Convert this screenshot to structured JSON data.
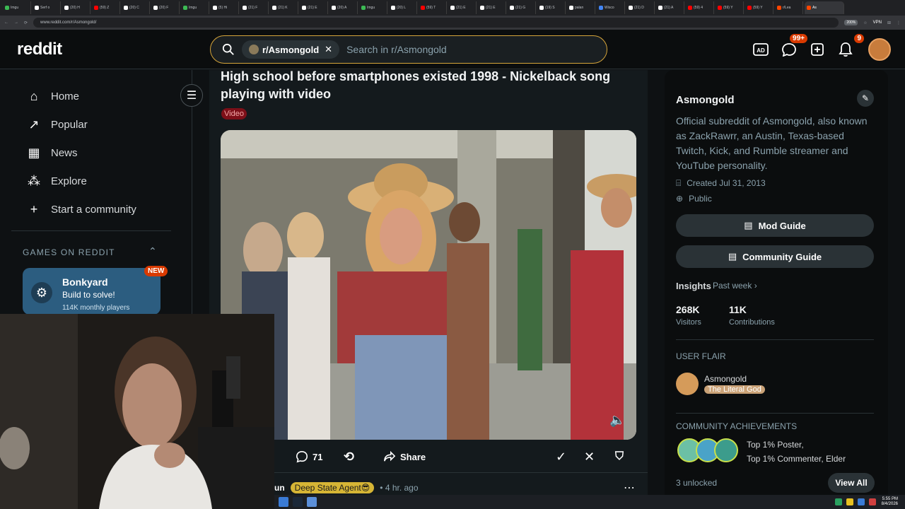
{
  "browser": {
    "tabs": [
      {
        "label": "Imgu",
        "color": "#3cba54"
      },
      {
        "label": "Serf o",
        "color": "#ffffff"
      },
      {
        "label": "(20) H",
        "color": "#ffffff"
      },
      {
        "label": "(59) Z",
        "color": "#ff0000"
      },
      {
        "label": "(20) C",
        "color": "#ffffff"
      },
      {
        "label": "(20) F",
        "color": "#ffffff"
      },
      {
        "label": "Imgu",
        "color": "#3cba54"
      },
      {
        "label": "(5) Hi",
        "color": "#ffffff"
      },
      {
        "label": "(21) F",
        "color": "#ffffff"
      },
      {
        "label": "(21) K",
        "color": "#ffffff"
      },
      {
        "label": "(21) E",
        "color": "#ffffff"
      },
      {
        "label": "(20) A",
        "color": "#ffffff"
      },
      {
        "label": "Imgu",
        "color": "#3cba54"
      },
      {
        "label": "(20) L",
        "color": "#ffffff"
      },
      {
        "label": "(59) T",
        "color": "#ff0000"
      },
      {
        "label": "(21) E",
        "color": "#ffffff"
      },
      {
        "label": "(21) E",
        "color": "#ffffff"
      },
      {
        "label": "(21) G",
        "color": "#ffffff"
      },
      {
        "label": "(19) S",
        "color": "#ffffff"
      },
      {
        "label": "palan",
        "color": "#ffffff"
      },
      {
        "label": "Wisco",
        "color": "#4285f4"
      },
      {
        "label": "(21) D",
        "color": "#ffffff"
      },
      {
        "label": "(21) A",
        "color": "#ffffff"
      },
      {
        "label": "(59) 4",
        "color": "#ff0000"
      },
      {
        "label": "(59) Y",
        "color": "#ff0000"
      },
      {
        "label": "(59) Y",
        "color": "#ff0000"
      },
      {
        "label": "r/Lea",
        "color": "#ff4500"
      }
    ],
    "active_tab": "As",
    "url": "www.reddit.com/r/Asmongold/",
    "zoom": "200%",
    "vpn": "VPN"
  },
  "header": {
    "logo": "reddit",
    "chip": "r/Asmongold",
    "search_placeholder": "Search in r/Asmongold",
    "chat_badge": "99+",
    "notif_badge": "9"
  },
  "leftnav": {
    "items": [
      {
        "label": "Home",
        "icon": "home-icon"
      },
      {
        "label": "Popular",
        "icon": "popular-icon"
      },
      {
        "label": "News",
        "icon": "news-icon"
      },
      {
        "label": "Explore",
        "icon": "explore-icon"
      },
      {
        "label": "Start a community",
        "icon": "plus-icon"
      }
    ],
    "games_header": "GAMES ON REDDIT",
    "game": {
      "title": "Bonkyard",
      "subtitle": "Build to solve!",
      "players": "114K monthly players",
      "badge": "NEW"
    }
  },
  "post": {
    "title": "High school before smartphones existed 1998 - Nickelback song playing with video",
    "flair": "Video",
    "comments": "71",
    "share": "Share",
    "next_user_prefix": "un",
    "next_flair": "Deep State Agent😎",
    "next_time": "4 hr. ago"
  },
  "sidebar": {
    "name": "Asmongold",
    "description": "Official subreddit of Asmongold, also known as ZackRawrr, an Austin, Texas-based Twitch, Kick, and Rumble streamer and YouTube personality.",
    "created": "Created Jul 31, 2013",
    "visibility": "Public",
    "mod_guide": "Mod Guide",
    "community_guide": "Community Guide",
    "insights": "Insights",
    "insights_range": "Past week",
    "visitors_value": "268K",
    "visitors_label": "Visitors",
    "contrib_value": "11K",
    "contrib_label": "Contributions",
    "user_flair_header": "USER FLAIR",
    "flair_user": "Asmongold",
    "flair_text": "The Literal God",
    "achievements_header": "COMMUNITY ACHIEVEMENTS",
    "achievement_line1": "Top 1% Poster,",
    "achievement_line2": "Top 1% Commenter, Elder",
    "unlocked": "3 unlocked",
    "view_all": "View All"
  },
  "taskbar": {
    "time": "5:55 PM",
    "date": "8/4/2026"
  }
}
